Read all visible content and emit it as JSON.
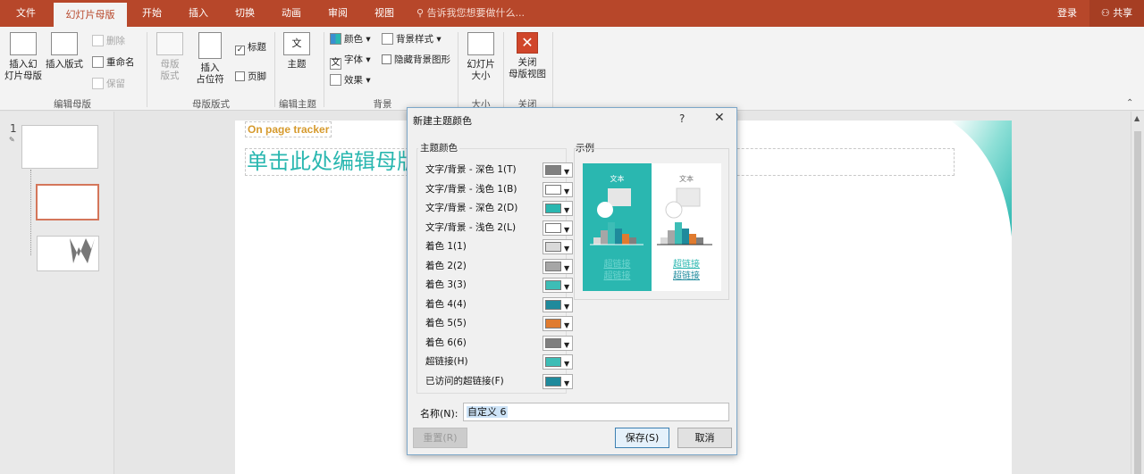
{
  "tabs": [
    {
      "label": "文件"
    },
    {
      "label": "幻灯片母版",
      "active": true
    },
    {
      "label": "开始"
    },
    {
      "label": "插入"
    },
    {
      "label": "切换"
    },
    {
      "label": "动画"
    },
    {
      "label": "审阅"
    },
    {
      "label": "视图"
    }
  ],
  "tell_me": "告诉我您想要做什么...",
  "login": "登录",
  "share": "共享",
  "ribbon": {
    "insert_master": "插入幻\n灯片母版",
    "insert_layout": "插入版式",
    "delete": "删除",
    "rename": "重命名",
    "preserve": "保留",
    "group_edit_master": "编辑母版",
    "master_layout": "母版\n版式",
    "insert_placeholder": "插入\n占位符",
    "title_chk": "标题",
    "footer_chk": "页脚",
    "group_master_layout": "母版版式",
    "themes": "主题",
    "group_edit_theme": "编辑主题",
    "colors": "颜色",
    "fonts": "字体",
    "effects": "效果",
    "bg_styles": "背景样式",
    "hide_bg": "隐藏背景图形",
    "group_background": "背景",
    "slide_size": "幻灯片\n大小",
    "group_size": "大小",
    "close_master": "关闭\n母版视图",
    "group_close": "关闭"
  },
  "slide_number": "1",
  "slide": {
    "tracker": "On page tracker",
    "title": "单击此处编辑母版"
  },
  "dialog": {
    "title": "新建主题颜色",
    "help": "?",
    "close": "✕",
    "theme_colors_legend": "主题颜色",
    "sample_legend": "示例",
    "rows": [
      {
        "label": "文字/背景 - 深色 1(T)",
        "color": "#808080"
      },
      {
        "label": "文字/背景 - 浅色 1(B)",
        "color": "#ffffff"
      },
      {
        "label": "文字/背景 - 深色 2(D)",
        "color": "#2ab7b0"
      },
      {
        "label": "文字/背景 - 浅色 2(L)",
        "color": "#ffffff"
      },
      {
        "label": "着色 1(1)",
        "color": "#d9d9d9"
      },
      {
        "label": "着色 2(2)",
        "color": "#a6a6a6"
      },
      {
        "label": "着色 3(3)",
        "color": "#3dbdb6"
      },
      {
        "label": "着色 4(4)",
        "color": "#1f8a9c"
      },
      {
        "label": "着色 5(5)",
        "color": "#e07b2f"
      },
      {
        "label": "着色 6(6)",
        "color": "#7f7f7f"
      },
      {
        "label": "超链接(H)",
        "color": "#3dbdb6"
      },
      {
        "label": "已访问的超链接(F)",
        "color": "#1f8a9c"
      }
    ],
    "preview": {
      "text_dark": "文本",
      "text_light": "文本",
      "hyperlink": "超链接",
      "visited": "超链接"
    },
    "name_label": "名称(N):",
    "name_value": "自定义 6",
    "reset": "重置(R)",
    "save": "保存(S)",
    "cancel": "取消"
  }
}
